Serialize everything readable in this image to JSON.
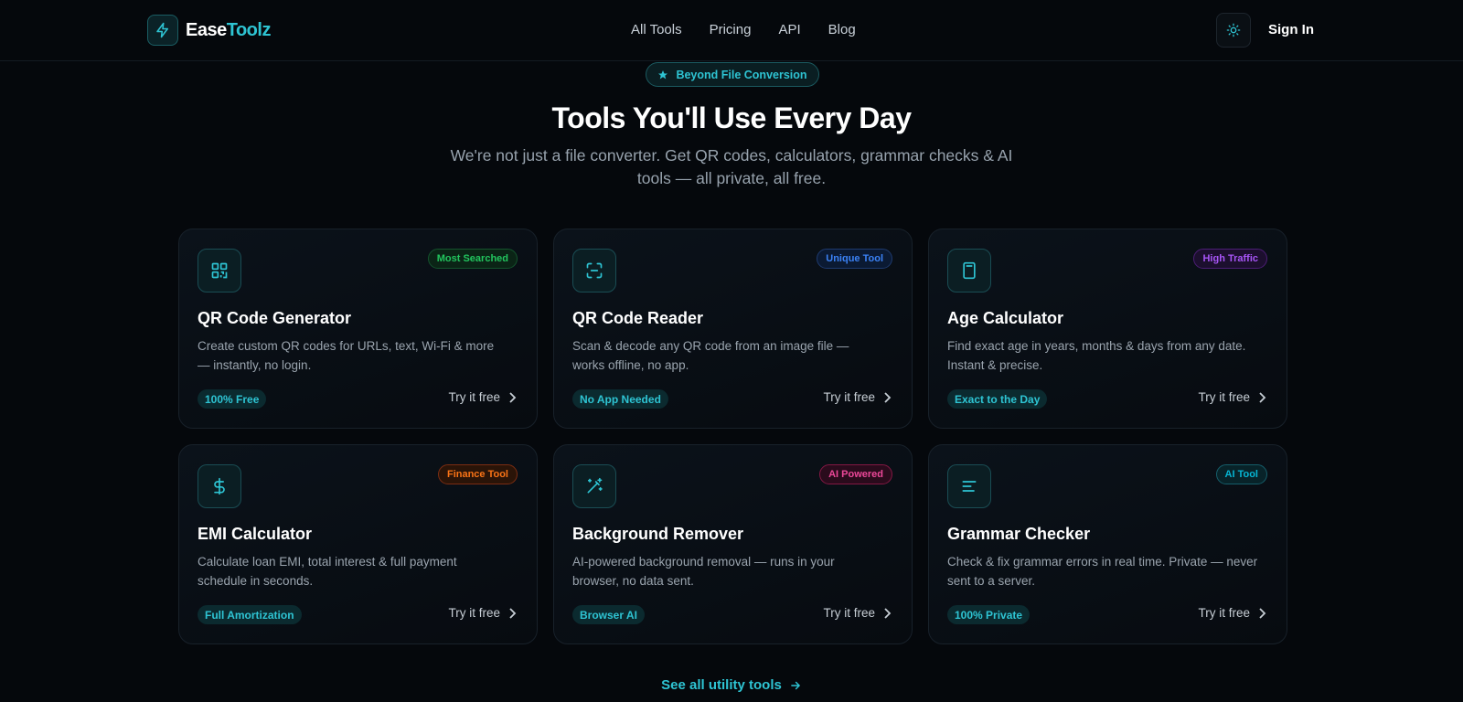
{
  "header": {
    "logo_part1": "Ease",
    "logo_part2": "Toolz",
    "nav": [
      "All Tools",
      "Pricing",
      "API",
      "Blog"
    ],
    "theme_icon": "sun-icon",
    "signin": "Sign In"
  },
  "hero": {
    "pill": "Beyond File Conversion",
    "title": "Tools You'll Use Every Day",
    "subtitle": "We're not just a file converter. Get QR codes, calculators, grammar checks & AI tools — all private, all free."
  },
  "cards": [
    {
      "icon": "qr-code-icon",
      "badge": "Most Searched",
      "badge_color": "#22c55e",
      "title": "QR Code Generator",
      "desc": "Create custom QR codes for URLs, text, Wi-Fi & more — instantly, no login.",
      "tag": "100% Free",
      "cta": "Try it free"
    },
    {
      "icon": "scan-icon",
      "badge": "Unique Tool",
      "badge_color": "#3b82f6",
      "title": "QR Code Reader",
      "desc": "Scan & decode any QR code from an image file — works offline, no app.",
      "tag": "No App Needed",
      "cta": "Try it free"
    },
    {
      "icon": "calculator-icon",
      "badge": "High Traffic",
      "badge_color": "#a855f7",
      "title": "Age Calculator",
      "desc": "Find exact age in years, months & days from any date. Instant & precise.",
      "tag": "Exact to the Day",
      "cta": "Try it free"
    },
    {
      "icon": "dollar-icon",
      "badge": "Finance Tool",
      "badge_color": "#f97316",
      "title": "EMI Calculator",
      "desc": "Calculate loan EMI, total interest & full payment schedule in seconds.",
      "tag": "Full Amortization",
      "cta": "Try it free"
    },
    {
      "icon": "magic-wand-icon",
      "badge": "AI Powered",
      "badge_color": "#ec4899",
      "title": "Background Remover",
      "desc": "AI-powered background removal — runs in your browser, no data sent.",
      "tag": "Browser AI",
      "cta": "Try it free"
    },
    {
      "icon": "text-align-icon",
      "badge": "AI Tool",
      "badge_color": "#06b6d4",
      "title": "Grammar Checker",
      "desc": "Check & fix grammar errors in real time. Private — never sent to a server.",
      "tag": "100% Private",
      "cta": "Try it free"
    }
  ],
  "see_all": "See all utility tools",
  "colors": {
    "accent": "#2ec4d3",
    "background": "#05080c"
  }
}
